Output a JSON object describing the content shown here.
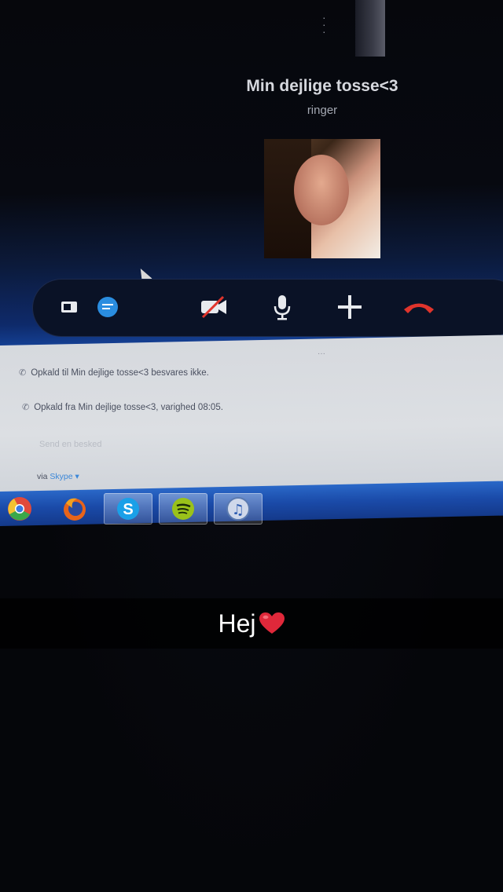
{
  "call": {
    "caller_name": "Min dejlige tosse<3",
    "status": "ringer"
  },
  "controls": [
    {
      "icon": "screen-share-icon"
    },
    {
      "icon": "chat-bubble-icon"
    },
    {
      "icon": "video-off-icon"
    },
    {
      "icon": "microphone-icon"
    },
    {
      "icon": "add-icon"
    },
    {
      "icon": "hang-up-icon"
    }
  ],
  "chat": {
    "messages": [
      "Opkald til Min dejlige tosse<3 besvares ikke.",
      "Opkald fra Min dejlige tosse<3, varighed 08:05."
    ],
    "input_placeholder": "Send en besked",
    "via_prefix": "via",
    "via_service": "Skype"
  },
  "taskbar": {
    "apps": [
      "chrome-icon",
      "firefox-icon",
      "skype-icon",
      "spotify-icon",
      "itunes-icon"
    ]
  },
  "caption": {
    "text": "Hej"
  },
  "colors": {
    "hang_up": "#e0342c",
    "skype_blue": "#3b87d8",
    "spotify_green": "#9ac21a"
  }
}
